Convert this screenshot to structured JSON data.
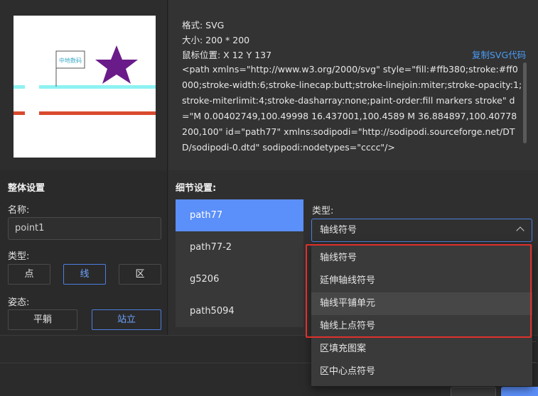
{
  "preview": {
    "flag_text": "中地数码",
    "colors": {
      "cyan_line": "#8ef2f2",
      "red_line": "#d94a2e",
      "star": "#6a1b8a"
    }
  },
  "info": {
    "format": "格式: SVG",
    "size": "大小: 200 * 200",
    "mouse_pos": "鼠标位置: X 12 Y 137",
    "copy_label": "复制SVG代码",
    "code": "<path xmlns=\"http://www.w3.org/2000/svg\" style=\"fill:#ffb380;stroke:#ff0000;stroke-width:6;stroke-linecap:butt;stroke-linejoin:miter;stroke-opacity:1;stroke-miterlimit:4;stroke-dasharray:none;paint-order:fill markers stroke\" d=\"M 0.00402749,100.49998 16.437001,100.4589 M 36.884897,100.40778 200,100\" id=\"path77\" xmlns:sodipodi=\"http://sodipodi.sourceforge.net/DTD/sodipodi-0.dtd\" sodipodi:nodetypes=\"cccc\"/>"
  },
  "overall": {
    "title": "整体设置",
    "name_label": "名称:",
    "name_value": "point1",
    "type_label": "类型:",
    "type_options": [
      "点",
      "线",
      "区"
    ],
    "type_selected": "线",
    "pose_label": "姿态:",
    "pose_options": [
      "平躺",
      "站立"
    ],
    "pose_selected": "站立"
  },
  "detail": {
    "title": "细节设置:",
    "list_items": [
      "path77",
      "path77-2",
      "g5206",
      "path5094"
    ],
    "list_selected": "path77",
    "type_label": "类型:",
    "type_value": "轴线符号",
    "dropdown_options": [
      "轴线符号",
      "延伸轴线符号",
      "轴线平铺单元",
      "轴线上点符号",
      "区填充图案",
      "区中心点符号"
    ],
    "dropdown_hover": "轴线平铺单元"
  },
  "accent_color": "#5b8ff9"
}
